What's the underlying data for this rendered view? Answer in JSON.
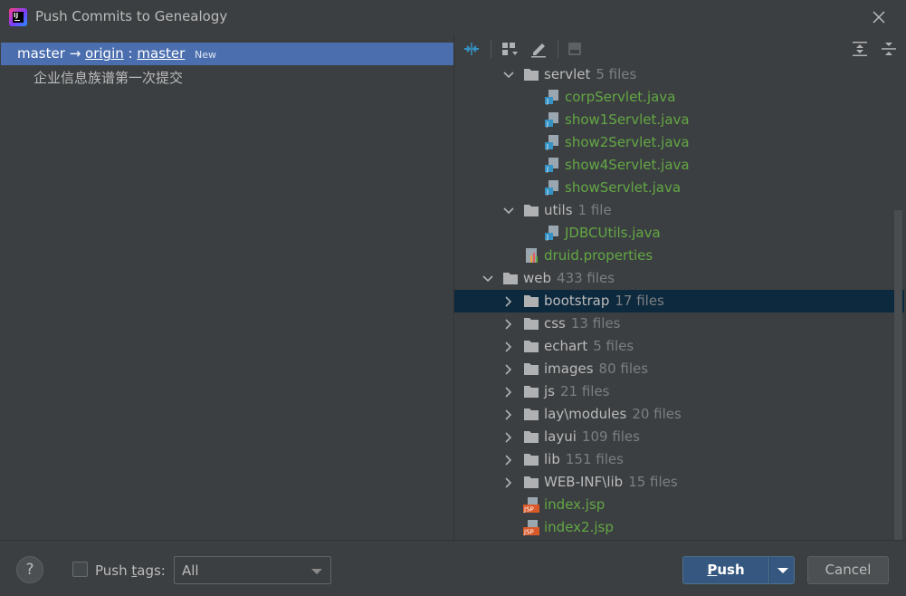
{
  "window": {
    "title": "Push Commits to Genealogy"
  },
  "left": {
    "branch": {
      "local": "master",
      "arrow": "→",
      "remote": "origin",
      "sep": ":",
      "remote_branch": "master",
      "badge": "New"
    },
    "commits": [
      "企业信息族谱第一次提交"
    ]
  },
  "toolbar": {
    "icons": [
      "compare-icon",
      "group-by-icon",
      "edit-source-icon",
      "preview-icon",
      "expand-all-icon",
      "collapse-all-icon"
    ]
  },
  "tree": {
    "rows": [
      {
        "kind": "dir",
        "level": 2,
        "expanded": true,
        "name": "servlet",
        "count": "5 files"
      },
      {
        "kind": "java",
        "level": 3,
        "name": "corpServlet.java"
      },
      {
        "kind": "java",
        "level": 3,
        "name": "show1Servlet.java"
      },
      {
        "kind": "java",
        "level": 3,
        "name": "show2Servlet.java"
      },
      {
        "kind": "java",
        "level": 3,
        "name": "show4Servlet.java"
      },
      {
        "kind": "java",
        "level": 3,
        "name": "showServlet.java"
      },
      {
        "kind": "dir",
        "level": 2,
        "expanded": true,
        "name": "utils",
        "count": "1 file"
      },
      {
        "kind": "java",
        "level": 3,
        "name": "JDBCUtils.java"
      },
      {
        "kind": "prop",
        "level": 2,
        "name": "druid.properties"
      },
      {
        "kind": "dir",
        "level": 1,
        "expanded": true,
        "name": "web",
        "count": "433 files"
      },
      {
        "kind": "dir",
        "level": 2,
        "expanded": false,
        "selected": true,
        "name": "bootstrap",
        "count": "17 files"
      },
      {
        "kind": "dir",
        "level": 2,
        "expanded": false,
        "name": "css",
        "count": "13 files"
      },
      {
        "kind": "dir",
        "level": 2,
        "expanded": false,
        "name": "echart",
        "count": "5 files"
      },
      {
        "kind": "dir",
        "level": 2,
        "expanded": false,
        "name": "images",
        "count": "80 files"
      },
      {
        "kind": "dir",
        "level": 2,
        "expanded": false,
        "name": "js",
        "count": "21 files"
      },
      {
        "kind": "dir",
        "level": 2,
        "expanded": false,
        "name": "lay\\modules",
        "count": "20 files"
      },
      {
        "kind": "dir",
        "level": 2,
        "expanded": false,
        "name": "layui",
        "count": "109 files"
      },
      {
        "kind": "dir",
        "level": 2,
        "expanded": false,
        "name": "lib",
        "count": "151 files"
      },
      {
        "kind": "dir",
        "level": 2,
        "expanded": false,
        "name": "WEB-INF\\lib",
        "count": "15 files"
      },
      {
        "kind": "jsp",
        "level": 2,
        "name": "index.jsp"
      },
      {
        "kind": "jsp",
        "level": 2,
        "name": "index2.jsp"
      }
    ]
  },
  "footer": {
    "help": "?",
    "push_tags_label_pre": "Push ",
    "push_tags_label_acc": "t",
    "push_tags_label_post": "ags:",
    "push_tags_checked": false,
    "push_tags_select": "All",
    "push_button_acc": "P",
    "push_button_rest": "ush",
    "cancel_button": "Cancel"
  }
}
